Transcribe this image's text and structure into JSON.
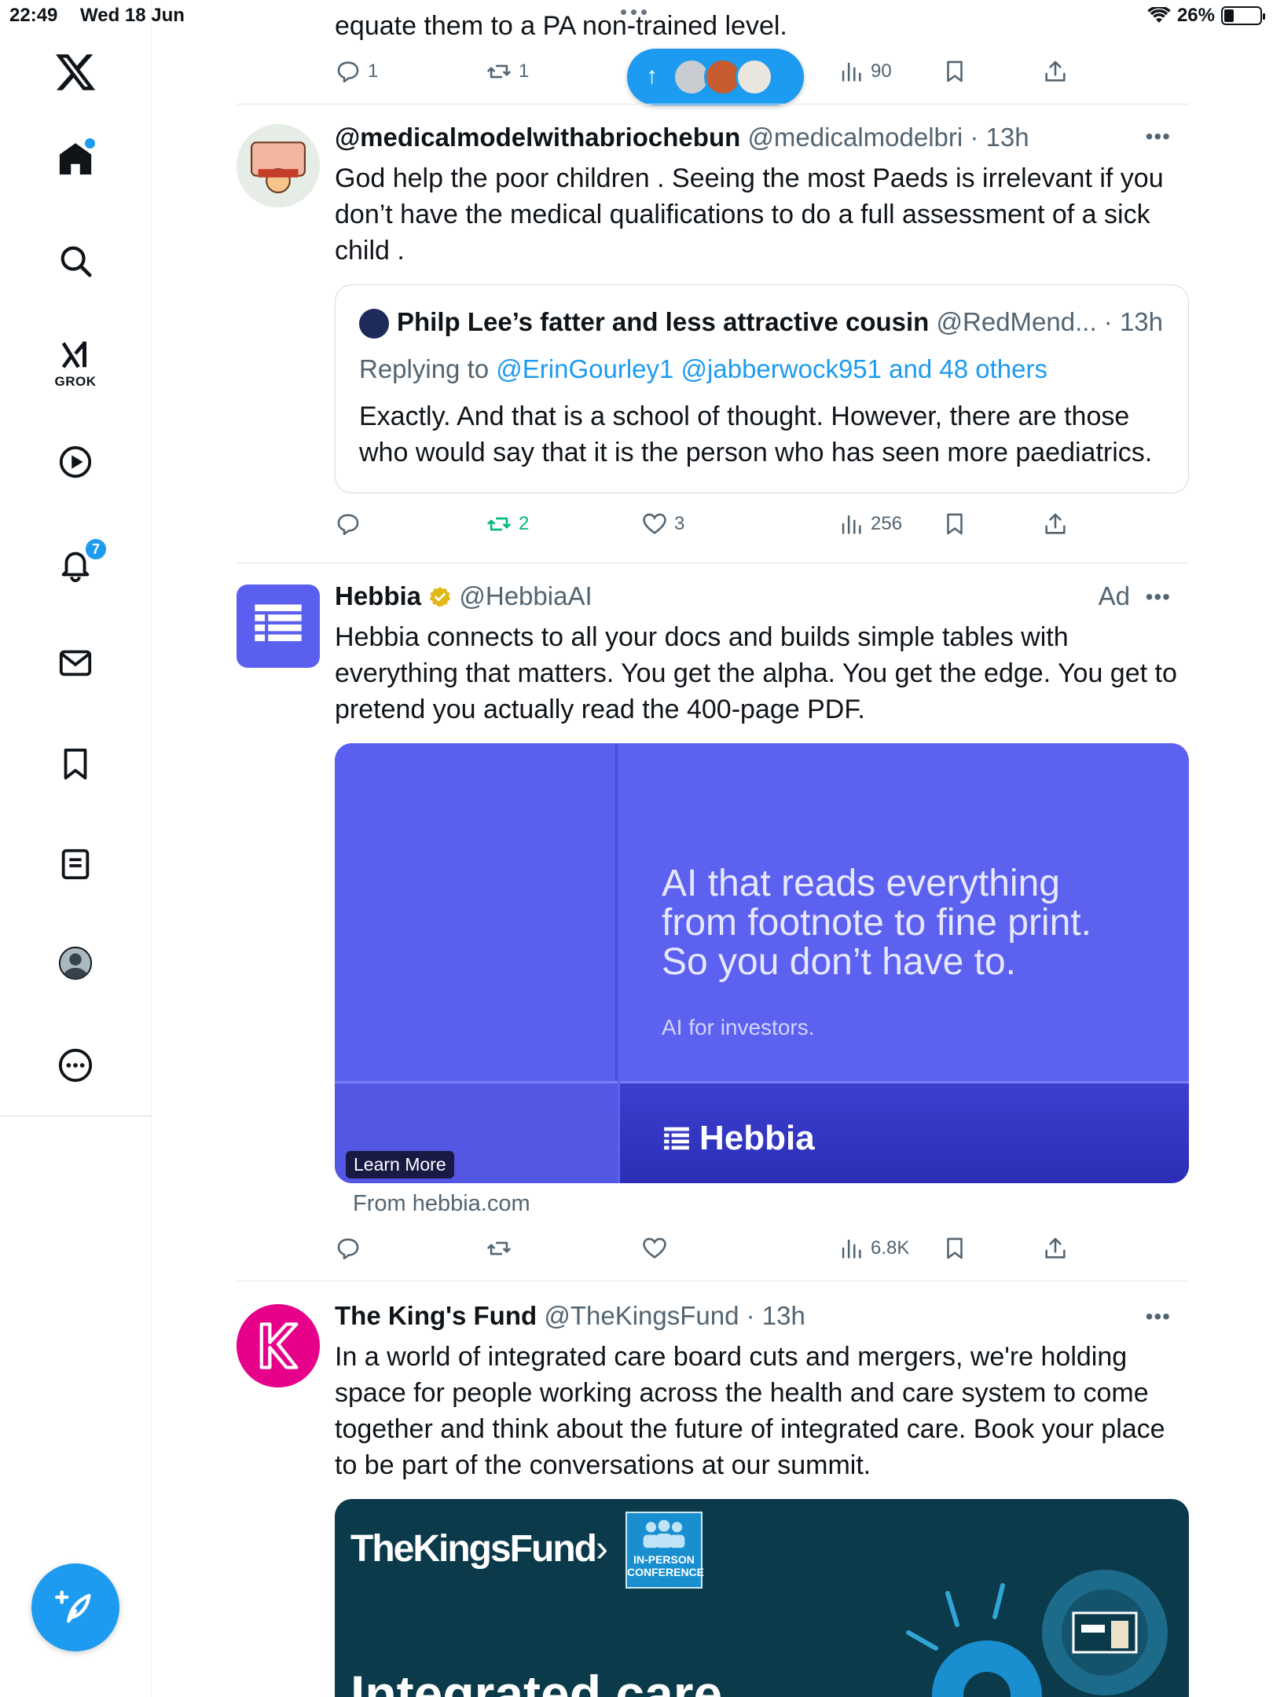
{
  "status_bar": {
    "time": "22:49",
    "date": "Wed 18 Jun",
    "battery": "26%"
  },
  "sidebar": {
    "grok_label": "GROK",
    "notifications_count": "7"
  },
  "top_post": {
    "text": "equate them to a PA non-trained level.",
    "replies": "1",
    "reposts": "1",
    "views": "90"
  },
  "post1": {
    "name": "@medicalmodelwithabriochebun",
    "handle": "@medicalmodelbri",
    "time": "· 13h",
    "text": "God help the poor children . Seeing the most Paeds is irrelevant if you don’t have the medical qualifications to do a full assessment of a sick child .",
    "quote": {
      "name": "Philp Lee’s fatter and less attractive cousin",
      "handle": "@RedMend...",
      "time": "· 13h",
      "replying_prefix": "Replying to",
      "replying_links": "@ErinGourley1 @jabberwock951 and 48 others",
      "text": "Exactly. And that is a school of thought. However, there are those who would say that it is the person who has seen more paediatrics."
    },
    "reposts": "2",
    "likes": "3",
    "views": "256"
  },
  "post2": {
    "name": "Hebbia",
    "handle": "@HebbiaAI",
    "ad_label": "Ad",
    "text": "Hebbia connects to all your docs and builds simple tables with everything that matters. You get the alpha. You get the edge. You get to pretend you actually read the 400-page PDF.",
    "card": {
      "headline_1": "AI that reads everything",
      "headline_2": "from footnote to fine print.",
      "headline_3": "So you don’t have to.",
      "sub": "AI for investors.",
      "brand": "Hebbia",
      "cta": "Learn More"
    },
    "from": "From hebbia.com",
    "views": "6.8K"
  },
  "post3": {
    "name": "The King's Fund",
    "handle": "@TheKingsFund",
    "time": "· 13h",
    "text": "In a world of integrated care board cuts and mergers, we're holding space for people working across the health and care system to come together and think about the future of integrated care. Book your place to be part of the conversations at our summit.",
    "card": {
      "brand": "TheKingsFund",
      "badge_1": "IN-PERSON",
      "badge_2": "CONFERENCE",
      "headline": "Integrated care"
    }
  },
  "colors": {
    "accent": "#1d9bf0",
    "repost_green": "#00ba7c",
    "hebbia": "#5b5ff0",
    "kingsfund_pink": "#e6008a",
    "kingsfund_dark": "#0b3a4a"
  }
}
